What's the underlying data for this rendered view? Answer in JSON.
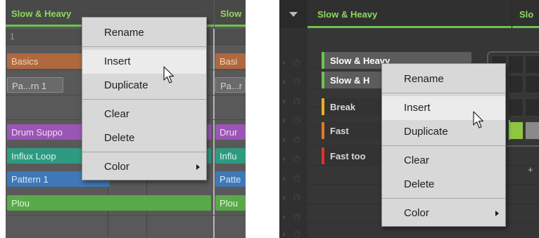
{
  "left": {
    "headers": [
      "Slow & Heavy",
      "Slow"
    ],
    "row_number": "1",
    "clips": {
      "basics": [
        "Basics",
        "Basi"
      ],
      "pattern": [
        "Pa...rn 1",
        "Pa...r"
      ],
      "drum": [
        "Drum Suppo",
        "Drur"
      ],
      "influx": [
        "Influx Loop",
        "Influ"
      ],
      "pat1": [
        "Pattern 1",
        "Patte"
      ],
      "plou": [
        "Plou",
        "Plou"
      ]
    },
    "menu": {
      "rename": "Rename",
      "insert": "Insert",
      "duplicate": "Duplicate",
      "clear": "Clear",
      "delete": "Delete",
      "color": "Color"
    }
  },
  "right": {
    "group_label": "Slow & Heavy",
    "group_label_2": "Slo",
    "scenes": [
      {
        "label": "Slow & Heavy",
        "color": "#6cc34f"
      },
      {
        "label": "Slow & H",
        "color": "#6cc34f"
      },
      {
        "label": "Break",
        "color": "#e8b21e"
      },
      {
        "label": "Fast",
        "color": "#e27a1e"
      },
      {
        "label": "Fast too",
        "color": "#e03030"
      }
    ],
    "add_symbol": "+",
    "menu": {
      "rename": "Rename",
      "insert": "Insert",
      "duplicate": "Duplicate",
      "clear": "Clear",
      "delete": "Delete",
      "color": "Color"
    }
  },
  "icons": [
    "mouse-pointer-icon",
    "power-icon",
    "chevron-right-icon",
    "triangle-down-icon"
  ],
  "colors": {
    "accent_green": "#6cc34f",
    "menu_bg": "#d8d8d8",
    "menu_highlight": "#ebebeb"
  }
}
